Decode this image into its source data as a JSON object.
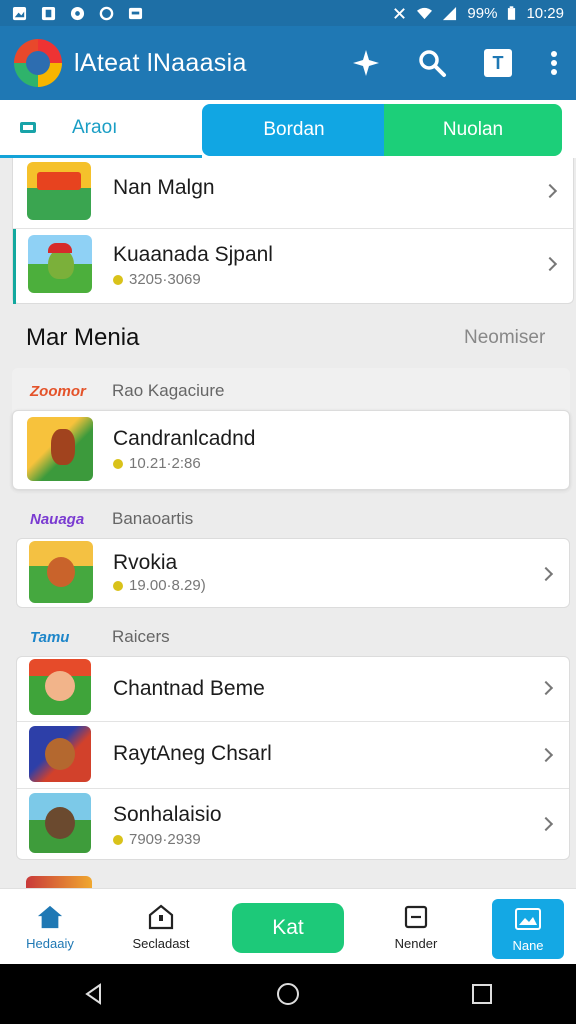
{
  "status_bar": {
    "battery": "99%",
    "time": "10:29"
  },
  "app_bar": {
    "title": "lAteat lNaaasia",
    "icons": [
      "sparkle-icon",
      "search-icon",
      "text-square-icon",
      "more-vertical-icon"
    ]
  },
  "tabs": [
    {
      "label": "Araoı",
      "active": true
    },
    {
      "label": "Bordan"
    },
    {
      "label": "Nuolan"
    }
  ],
  "top_list": [
    {
      "title": "Nan Malgn",
      "sub": ""
    },
    {
      "title": "Kuaanada Sjpanl",
      "sub": "3205·3069"
    }
  ],
  "section": {
    "title": "Mar Menia",
    "more": "Neomiser"
  },
  "groups": [
    {
      "logo": "Zoomor",
      "name": "Rao Kagaciure",
      "items": [
        {
          "title": "Candranlcadnd",
          "sub": "10.21·2:86"
        }
      ]
    },
    {
      "logo": "Nauaga",
      "name": "Banaoartis",
      "items": [
        {
          "title": "Rvokia",
          "sub": "19.00·8.29)"
        }
      ]
    },
    {
      "logo": "Tamu",
      "name": "Raicers",
      "items": [
        {
          "title": "Chantnad Beme",
          "sub": ""
        },
        {
          "title": "RaytAneg Chsarl",
          "sub": ""
        },
        {
          "title": "Sonhalaisio",
          "sub": "7909·2939"
        }
      ]
    }
  ],
  "bottom_nav": [
    {
      "label": "Hedaaiy"
    },
    {
      "label": "Secladast"
    },
    {
      "label": "Kat"
    },
    {
      "label": "Nender"
    },
    {
      "label": "Nane"
    }
  ],
  "colors": {
    "primary": "#1f78b4",
    "accent_blue": "#11a6e3",
    "accent_green": "#1ccf79"
  }
}
